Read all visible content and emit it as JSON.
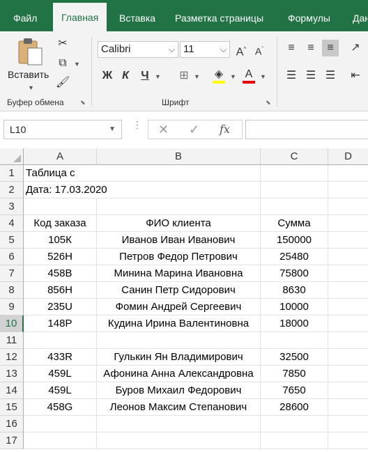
{
  "tabs": [
    {
      "label": "Файл",
      "active": false
    },
    {
      "label": "Главная",
      "active": true
    },
    {
      "label": "Вставка",
      "active": false
    },
    {
      "label": "Разметка страницы",
      "active": false
    },
    {
      "label": "Формулы",
      "active": false
    },
    {
      "label": "Дан",
      "active": false
    }
  ],
  "ribbon": {
    "clipboard": {
      "paste_label": "Вставить",
      "group_label": "Буфер обмена"
    },
    "font": {
      "font_name": "Calibri",
      "font_size": "11",
      "bold": "Ж",
      "italic": "К",
      "underline": "Ч",
      "font_color_glyph": "A",
      "group_label": "Шрифт"
    },
    "colors": {
      "accent": "#217346",
      "highlight": "#ffff00",
      "font_color": "#e00000"
    }
  },
  "formula_bar": {
    "name_box": "L10",
    "fx": "fx",
    "value": ""
  },
  "columns": [
    "A",
    "B",
    "C",
    "D"
  ],
  "rows": [
    {
      "num": "1",
      "a": "Таблица с",
      "b": "",
      "c": ""
    },
    {
      "num": "2",
      "a": "Дата: 17.03.2020",
      "b": "",
      "c": ""
    },
    {
      "num": "3",
      "a": "",
      "b": "",
      "c": ""
    },
    {
      "num": "4",
      "a": "Код заказа",
      "b": "ФИО клиента",
      "c": "Сумма"
    },
    {
      "num": "5",
      "a": "105К",
      "b": "Иванов Иван Иванович",
      "c": "150000"
    },
    {
      "num": "6",
      "a": "526Н",
      "b": "Петров Федор Петрович",
      "c": "25480"
    },
    {
      "num": "7",
      "a": "458В",
      "b": "Минина Марина Ивановна",
      "c": "75800"
    },
    {
      "num": "8",
      "a": "856Н",
      "b": "Санин Петр Сидорович",
      "c": "8630"
    },
    {
      "num": "9",
      "a": "235U",
      "b": "Фомин Андрей Сергеевич",
      "c": "10000"
    },
    {
      "num": "10",
      "a": "148Р",
      "b": "Кудина Ирина Валентиновна",
      "c": "18000"
    },
    {
      "num": "11",
      "a": "",
      "b": "",
      "c": ""
    },
    {
      "num": "12",
      "a": "433R",
      "b": "Гулькин Ян Владимирович",
      "c": "32500"
    },
    {
      "num": "13",
      "a": "459L",
      "b": "Афонина Анна Александровна",
      "c": "7850"
    },
    {
      "num": "14",
      "a": "459L",
      "b": "Буров Михаил Федорович",
      "c": "7650"
    },
    {
      "num": "15",
      "a": "458G",
      "b": "Леонов Максим Степанович",
      "c": "28600"
    },
    {
      "num": "16",
      "a": "",
      "b": "",
      "c": ""
    },
    {
      "num": "17",
      "a": "",
      "b": "",
      "c": ""
    }
  ],
  "active_row": "10"
}
